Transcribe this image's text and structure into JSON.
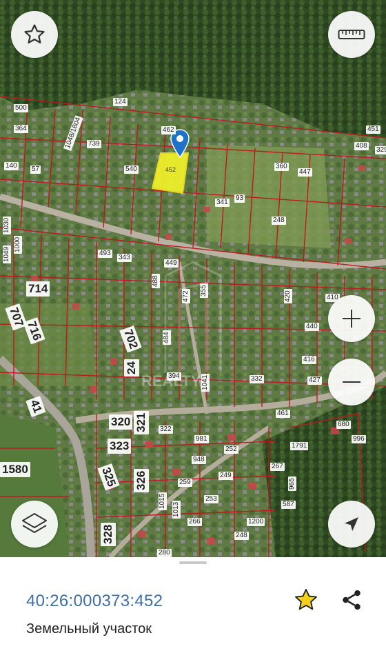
{
  "map": {
    "watermark": "REALTY",
    "selected_parcel": {
      "label": "452"
    },
    "parcel_labels": [
      {
        "text": "500"
      },
      {
        "text": "124"
      },
      {
        "text": "364"
      },
      {
        "text": "462"
      },
      {
        "text": "140"
      },
      {
        "text": "57"
      },
      {
        "text": "1048/1804"
      },
      {
        "text": "739"
      },
      {
        "text": "540"
      },
      {
        "text": "360"
      },
      {
        "text": "447"
      },
      {
        "text": "408"
      },
      {
        "text": "451"
      },
      {
        "text": "329"
      },
      {
        "text": "341"
      },
      {
        "text": "93"
      },
      {
        "text": "248"
      },
      {
        "text": "449"
      },
      {
        "text": "343"
      },
      {
        "text": "493"
      },
      {
        "text": "1030"
      },
      {
        "text": "1000"
      },
      {
        "text": "1049"
      },
      {
        "text": "714"
      },
      {
        "text": "707"
      },
      {
        "text": "716"
      },
      {
        "text": "702"
      },
      {
        "text": "24"
      },
      {
        "text": "394"
      },
      {
        "text": "332"
      },
      {
        "text": "427"
      },
      {
        "text": "461"
      },
      {
        "text": "41"
      },
      {
        "text": "1580"
      },
      {
        "text": "320"
      },
      {
        "text": "321"
      },
      {
        "text": "323"
      },
      {
        "text": "325"
      },
      {
        "text": "326"
      },
      {
        "text": "328"
      },
      {
        "text": "322"
      },
      {
        "text": "981"
      },
      {
        "text": "948"
      },
      {
        "text": "252"
      },
      {
        "text": "249"
      },
      {
        "text": "259"
      },
      {
        "text": "253"
      },
      {
        "text": "266"
      },
      {
        "text": "248"
      },
      {
        "text": "280"
      },
      {
        "text": "1200"
      },
      {
        "text": "1791"
      },
      {
        "text": "680"
      },
      {
        "text": "996"
      },
      {
        "text": "587"
      },
      {
        "text": "267"
      },
      {
        "text": "965"
      },
      {
        "text": "1015"
      },
      {
        "text": "1013"
      },
      {
        "text": "1041"
      },
      {
        "text": "410"
      },
      {
        "text": "440"
      },
      {
        "text": "416"
      },
      {
        "text": "472"
      },
      {
        "text": "355"
      },
      {
        "text": "488"
      },
      {
        "text": "484"
      },
      {
        "text": "420"
      }
    ]
  },
  "controls": {
    "favorite_map_icon": "star-outline-icon",
    "ruler_icon": "ruler-icon",
    "zoom_in_icon": "plus-icon",
    "zoom_out_icon": "minus-icon",
    "layers_icon": "layers-icon",
    "locate_icon": "navigation-arrow-icon"
  },
  "sheet": {
    "cadastral_number": "40:26:000373:452",
    "object_type": "Земельный участок",
    "favorite_icon": "star-icon",
    "share_icon": "share-icon"
  },
  "colors": {
    "boundary": "#c0181e",
    "selected_fill": "#f2f22a",
    "marker": "#1e73c8",
    "link": "#3d6fa8",
    "favorite": "#f2cf1a"
  }
}
